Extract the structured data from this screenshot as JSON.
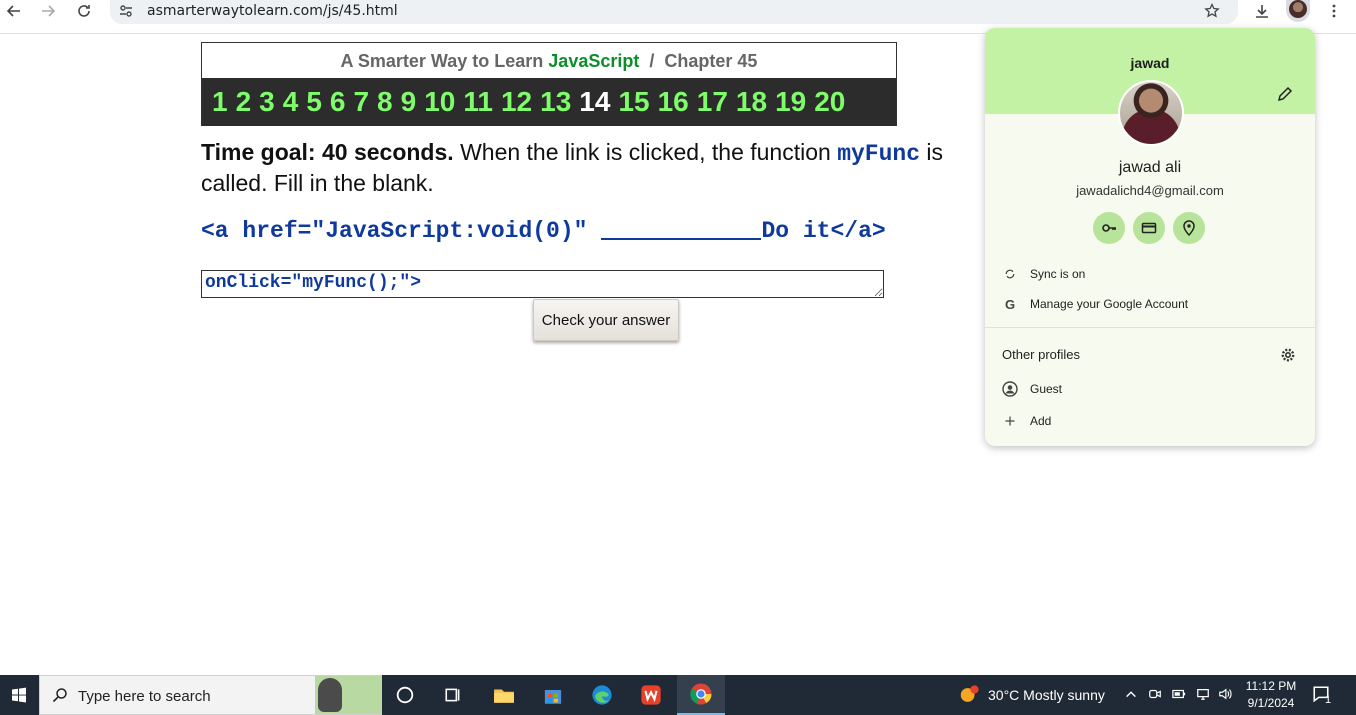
{
  "browser": {
    "url": "asmarterwaytolearn.com/js/45.html"
  },
  "page": {
    "title_prefix": "A Smarter Way to Learn",
    "title_js": "JavaScript",
    "title_sep": "/",
    "title_chapter": "Chapter 45",
    "chapters": [
      "1",
      "2",
      "3",
      "4",
      "5",
      "6",
      "7",
      "8",
      "9",
      "10",
      "11",
      "12",
      "13",
      "14",
      "15",
      "16",
      "17",
      "18",
      "19",
      "20"
    ],
    "current_chapter": "14",
    "time_goal": "Time goal: 40 seconds.",
    "question_part1": "When the link is clicked, the function",
    "question_code": "myFunc",
    "question_part2": "is called. Fill in the blank.",
    "code_before": "<a href=\"JavaScript:void(0)\"",
    "code_after": "Do it</a>",
    "answer_value": "onClick=\"myFunc();\">",
    "check_button": "Check your answer"
  },
  "profile": {
    "name_top": "jawad",
    "full_name": "jawad ali",
    "email": "jawadalichd4@gmail.com",
    "quick_icons": [
      "key-icon",
      "card-icon",
      "location-icon"
    ],
    "sync": "Sync is on",
    "manage": "Manage your Google Account",
    "other_profiles": "Other profiles",
    "guest": "Guest",
    "add": "Add",
    "header_color": "#c3f2a5"
  },
  "taskbar": {
    "search_placeholder": "Type here to search",
    "weather": "30°C  Mostly sunny",
    "time": "11:12 PM",
    "date": "9/1/2024",
    "notif_count": "1"
  }
}
